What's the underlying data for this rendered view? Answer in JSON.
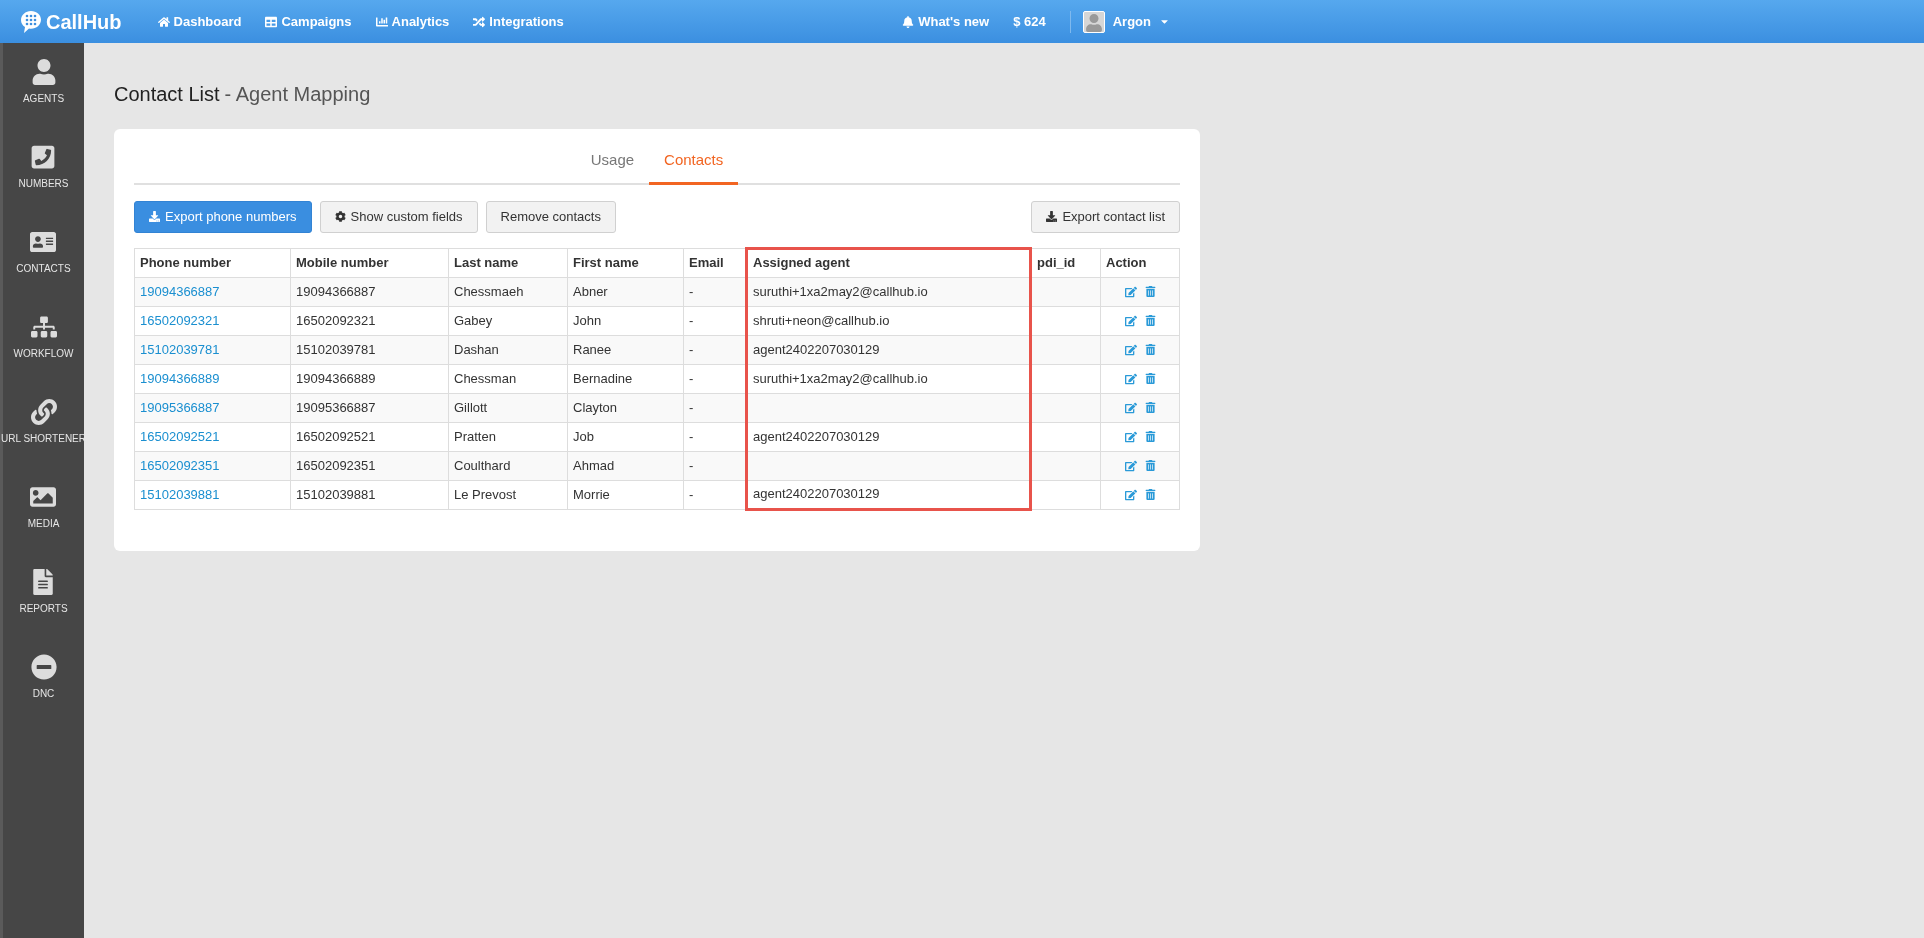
{
  "app": {
    "logo": "CallHub"
  },
  "nav": [
    {
      "label": "Dashboard",
      "kind": "home"
    },
    {
      "label": "Campaigns",
      "kind": "table"
    },
    {
      "label": "Analytics",
      "kind": "chart"
    },
    {
      "label": "Integrations",
      "kind": "shuffle"
    }
  ],
  "top_right": {
    "whats_new": "What's new",
    "balance": "$ 624",
    "user": "Argon"
  },
  "sidebar": [
    {
      "label": "AGENTS",
      "kind": "agents"
    },
    {
      "label": "NUMBERS",
      "kind": "numbers"
    },
    {
      "label": "CONTACTS",
      "kind": "contacts"
    },
    {
      "label": "WORKFLOW",
      "kind": "workflow"
    },
    {
      "label": "URL SHORTENER",
      "kind": "link"
    },
    {
      "label": "MEDIA",
      "kind": "media"
    },
    {
      "label": "REPORTS",
      "kind": "reports"
    },
    {
      "label": "DNC",
      "kind": "dnc"
    }
  ],
  "page": {
    "title": "Contact List",
    "subtitle": "- Agent Mapping"
  },
  "tabs": [
    {
      "label": "Usage",
      "selected": false
    },
    {
      "label": "Contacts",
      "selected": true
    }
  ],
  "buttons": [
    {
      "label": "Export phone numbers",
      "kind": "export"
    },
    {
      "label": "Show custom fields",
      "kind": "settings"
    },
    {
      "label": "Remove contacts",
      "kind": "remove"
    }
  ],
  "right_button": {
    "label": "Export contact list",
    "kind": "export"
  },
  "table": {
    "columns": [
      {
        "label": "Phone number",
        "highlighted": false
      },
      {
        "label": "Mobile number",
        "highlighted": false
      },
      {
        "label": "Last name",
        "highlighted": false
      },
      {
        "label": "First name",
        "highlighted": false
      },
      {
        "label": "Email",
        "highlighted": false
      },
      {
        "label": "Assigned agent",
        "highlighted": true
      },
      {
        "label": "pdi_id",
        "highlighted": false
      },
      {
        "label": "Action",
        "highlighted": false
      }
    ],
    "rows": [
      {
        "phone": "19094366887",
        "mobile": "19094366887",
        "last": "Chessmaeh",
        "first": "Abner",
        "email": "-",
        "agent": "suruthi+1xa2may2@callhub.io"
      },
      {
        "phone": "16502092321",
        "mobile": "16502092321",
        "last": "Gabey",
        "first": "John",
        "email": "-",
        "agent": "shruti+neon@callhub.io"
      },
      {
        "phone": "15102039781",
        "mobile": "15102039781",
        "last": "Dashan",
        "first": "Ranee",
        "email": "-",
        "agent": "agent2402207030129"
      },
      {
        "phone": "19094366889",
        "mobile": "19094366889",
        "last": "Chessman",
        "first": "Bernadine",
        "email": "-",
        "agent": "suruthi+1xa2may2@callhub.io"
      },
      {
        "phone": "19095366887",
        "mobile": "19095366887",
        "last": "Gillott",
        "first": "Clayton",
        "email": "-"
      },
      {
        "phone": "16502092521",
        "mobile": "16502092521",
        "last": "Pratten",
        "first": "Job",
        "email": "-",
        "agent": "agent2402207030129"
      },
      {
        "phone": "16502092351",
        "mobile": "16502092351",
        "last": "Coulthard",
        "first": "Ahmad",
        "email": "-"
      },
      {
        "phone": "15102039881",
        "mobile": "15102039881",
        "last": "Le Prevost",
        "first": "Morrie",
        "email": "-",
        "agent": "agent2402207030129"
      }
    ]
  }
}
